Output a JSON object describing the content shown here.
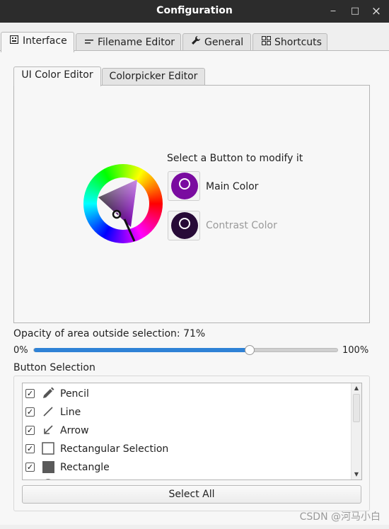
{
  "window": {
    "title": "Configuration",
    "minimize": "‒",
    "maximize": "□",
    "close": "×"
  },
  "main_tabs": [
    {
      "label": "Interface",
      "icon": "interface-icon",
      "active": true
    },
    {
      "label": "Filename Editor",
      "icon": "text-lines-icon",
      "active": false
    },
    {
      "label": "General",
      "icon": "wrench-icon",
      "active": false
    },
    {
      "label": "Shortcuts",
      "icon": "grid-icon",
      "active": false
    }
  ],
  "inner_tabs": [
    {
      "label": "UI Color Editor",
      "active": true
    },
    {
      "label": "Colorpicker Editor",
      "active": false
    }
  ],
  "color_editor": {
    "prompt": "Select a Button to modify it",
    "main_color_label": "Main Color",
    "contrast_color_label": "Contrast Color",
    "main_color": "#7a0ba0",
    "contrast_color": "#270a37"
  },
  "opacity": {
    "label": "Opacity of area outside selection: 71%",
    "min_label": "0%",
    "max_label": "100%",
    "value": 0.71
  },
  "button_selection": {
    "label": "Button Selection",
    "items": [
      {
        "label": "Pencil",
        "checked": true,
        "icon": "pencil-icon"
      },
      {
        "label": "Line",
        "checked": true,
        "icon": "line-icon"
      },
      {
        "label": "Arrow",
        "checked": true,
        "icon": "arrow-icon"
      },
      {
        "label": "Rectangular Selection",
        "checked": true,
        "icon": "rectangular-selection-icon"
      },
      {
        "label": "Rectangle",
        "checked": true,
        "icon": "rectangle-icon"
      }
    ],
    "select_all_label": "Select All"
  },
  "watermark": "CSDN @河马小白",
  "accent_color": "#2f82d6"
}
